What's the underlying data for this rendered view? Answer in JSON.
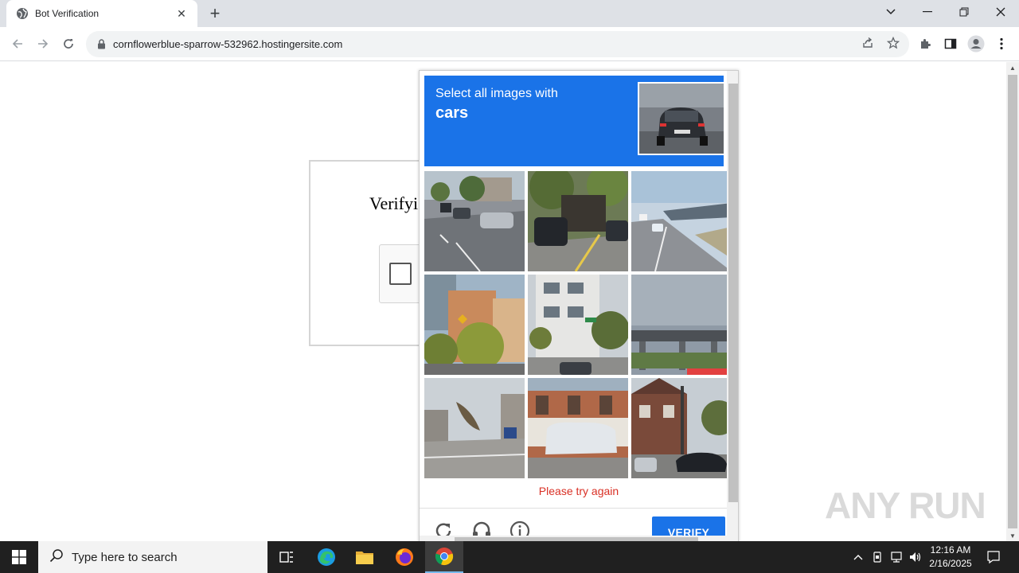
{
  "browser": {
    "tab_title": "Bot Verification",
    "url": "cornflowerblue-sparrow-532962.hostingersite.com"
  },
  "page": {
    "heading": "Verifyi"
  },
  "challenge": {
    "instruction": "Select all images with",
    "target": "cars",
    "error": "Please try again",
    "verify_label": "VERIFY",
    "tiles": [
      {
        "name": "street-cars"
      },
      {
        "name": "truck-cars"
      },
      {
        "name": "highway-bridge"
      },
      {
        "name": "buildings-trees"
      },
      {
        "name": "white-building"
      },
      {
        "name": "overpass"
      },
      {
        "name": "intersection"
      },
      {
        "name": "brick-building"
      },
      {
        "name": "street-corner-cars"
      }
    ],
    "accent_color": "#1a73e8",
    "error_color": "#d93025"
  },
  "watermark": "ANY RUN",
  "taskbar": {
    "search_placeholder": "Type here to search",
    "time": "12:16 AM",
    "date": "2/16/2025"
  }
}
